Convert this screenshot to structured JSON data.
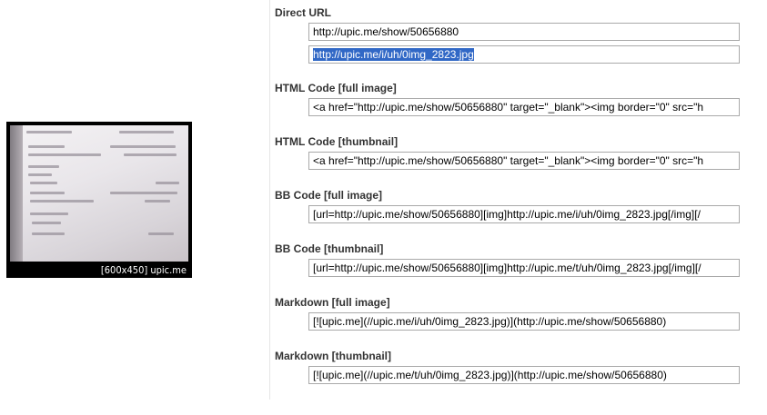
{
  "thumbnail": {
    "caption": "[600x450] upic.me"
  },
  "sections": {
    "direct_url": {
      "label": "Direct URL",
      "value_show": "http://upic.me/show/50656880",
      "value_image": "http://upic.me/i/uh/0img_2823.jpg"
    },
    "html_full": {
      "label": "HTML Code [full image]",
      "value": "<a href=\"http://upic.me/show/50656880\" target=\"_blank\"><img border=\"0\" src=\"h"
    },
    "html_thumb": {
      "label": "HTML Code [thumbnail]",
      "value": "<a href=\"http://upic.me/show/50656880\" target=\"_blank\"><img border=\"0\" src=\"h"
    },
    "bb_full": {
      "label": "BB Code [full image]",
      "value": "[url=http://upic.me/show/50656880][img]http://upic.me/i/uh/0img_2823.jpg[/img][/"
    },
    "bb_thumb": {
      "label": "BB Code [thumbnail]",
      "value": "[url=http://upic.me/show/50656880][img]http://upic.me/t/uh/0img_2823.jpg[/img][/"
    },
    "md_full": {
      "label": "Markdown [full image]",
      "value": "[![upic.me](//upic.me/i/uh/0img_2823.jpg)](http://upic.me/show/50656880)"
    },
    "md_thumb": {
      "label": "Markdown [thumbnail]",
      "value": "[![upic.me](//upic.me/t/uh/0img_2823.jpg)](http://upic.me/show/50656880)"
    }
  },
  "colors": {
    "selection": "#3168c6",
    "label": "#333333",
    "field_border": "#a9a9a9"
  }
}
